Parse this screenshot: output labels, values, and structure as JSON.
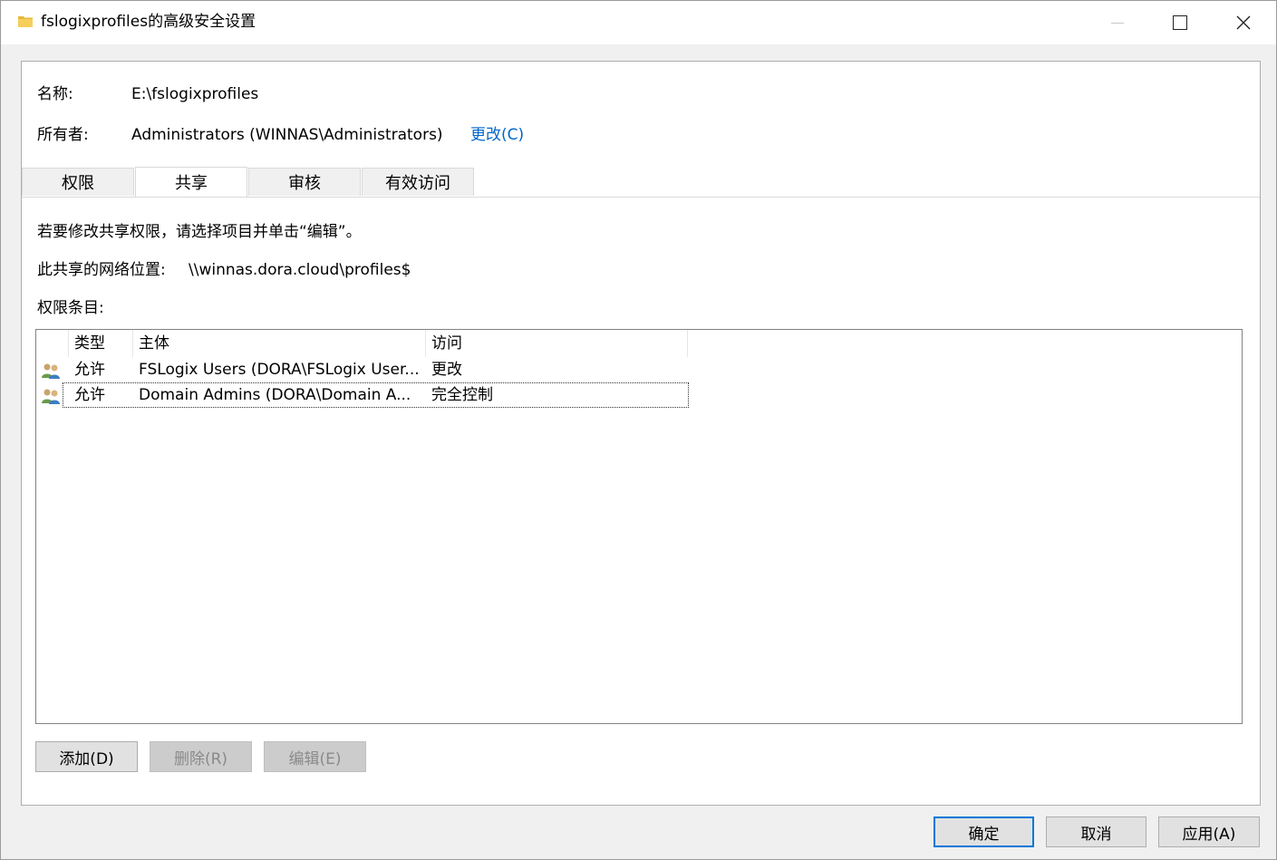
{
  "window": {
    "title": "fslogixprofiles的高级安全设置",
    "minimize_icon": "minimize-icon",
    "maximize_icon": "maximize-icon",
    "close_icon": "close-icon",
    "close_glyph": "✕"
  },
  "info": {
    "name_label": "名称:",
    "name_value": "E:\\fslogixprofiles",
    "owner_label": "所有者:",
    "owner_value": "Administrators (WINNAS\\Administrators)",
    "owner_change_link": "更改(C)"
  },
  "tabs": [
    {
      "label": "权限",
      "active": false
    },
    {
      "label": "共享",
      "active": true
    },
    {
      "label": "审核",
      "active": false
    },
    {
      "label": "有效访问",
      "active": false
    }
  ],
  "share_tab": {
    "instruction": "若要修改共享权限，请选择项目并单击“编辑”。",
    "network_location_label": "此共享的网络位置:",
    "network_location_value": "\\\\winnas.dora.cloud\\profiles$",
    "entries_label": "权限条目:",
    "columns": [
      "类型",
      "主体",
      "访问"
    ],
    "rows": [
      {
        "type": "允许",
        "principal": "FSLogix Users (DORA\\FSLogix User...",
        "access": "更改",
        "icon": "user-group-icon",
        "focused": false
      },
      {
        "type": "允许",
        "principal": "Domain Admins (DORA\\Domain A...",
        "access": "完全控制",
        "icon": "user-group-icon",
        "focused": true
      }
    ],
    "buttons": {
      "add": "添加(D)",
      "remove": "删除(R)",
      "edit": "编辑(E)"
    }
  },
  "footer": {
    "ok": "确定",
    "cancel": "取消",
    "apply": "应用(A)"
  },
  "colors": {
    "link": "#0066cc",
    "default_button_border": "#0078d7",
    "folder": "#e8b73c"
  }
}
